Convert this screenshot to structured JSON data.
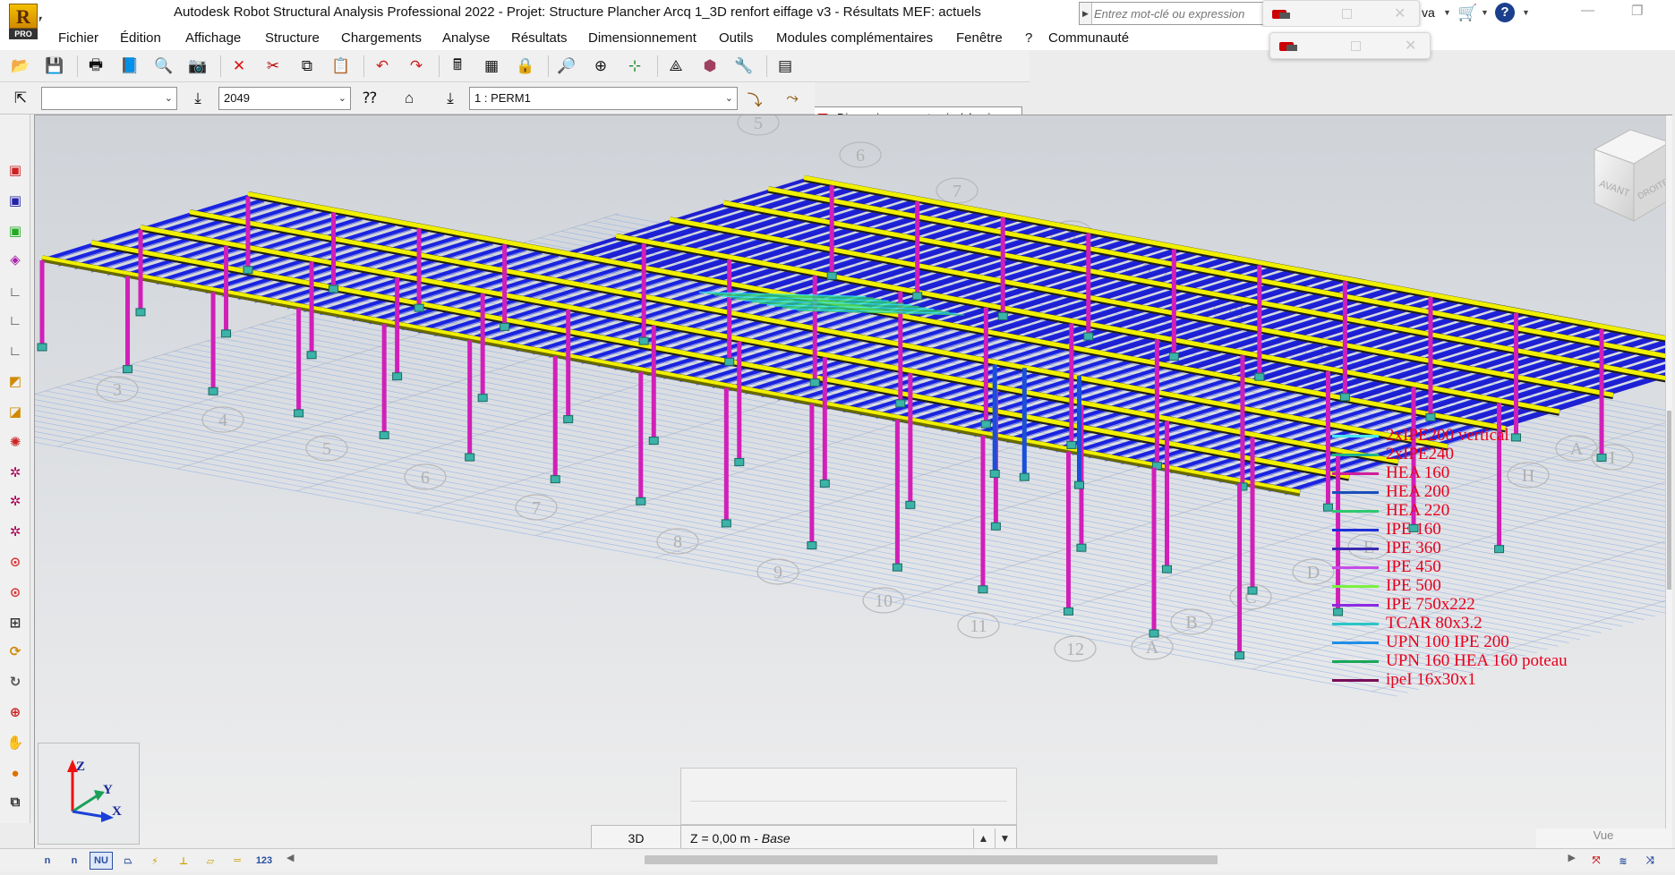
{
  "titlebar": {
    "title": "Autodesk Robot Structural Analysis Professional 2022 - Projet: Structure Plancher Arcq 1_3D renfort eiffage v3 - Résultats MEF: actuels",
    "logo_letter": "R",
    "logo_badge": "PRO",
    "search_placeholder": "Entrez mot-clé ou expression",
    "user_label": "va",
    "help_label": "?"
  },
  "menu": [
    "Fichier",
    "Édition",
    "Affichage",
    "Structure",
    "Chargements",
    "Analyse",
    "Résultats",
    "Dimensionnement",
    "Outils",
    "Modules complémentaires",
    "Fenêtre",
    "?",
    "Communauté"
  ],
  "toolbar": {
    "design_mode": "Dimensionnement acier/alumin",
    "selection_value": "",
    "load_case_number": "2049",
    "load_case": "1 : PERM1"
  },
  "legend": [
    {
      "label": "2xIPE200 vertical",
      "color": "#46e8f2"
    },
    {
      "label": "2xIPE240",
      "color": "#22b38a"
    },
    {
      "label": "HEA 160",
      "color": "#d11f9b"
    },
    {
      "label": "HEA 200",
      "color": "#1a4fb8"
    },
    {
      "label": "HEA 220",
      "color": "#2ec96e"
    },
    {
      "label": "IPE 160",
      "color": "#1d2fd8"
    },
    {
      "label": "IPE 360",
      "color": "#3a2bb0"
    },
    {
      "label": "IPE 450",
      "color": "#c64de8"
    },
    {
      "label": "IPE 500",
      "color": "#7cf040"
    },
    {
      "label": "IPE 750x222",
      "color": "#8c2ae0"
    },
    {
      "label": "TCAR 80x3.2",
      "color": "#2ac6c6"
    },
    {
      "label": "UPN 100 IPE 200",
      "color": "#1f8ee8"
    },
    {
      "label": "UPN 160 HEA 160 poteau",
      "color": "#19a858"
    },
    {
      "label": "ipeI 16x30x1",
      "color": "#7a0e5a"
    }
  ],
  "viewcube": {
    "front": "AVANT",
    "right": "DROITE"
  },
  "grid_labels": {
    "top_numbers": [
      "5",
      "6",
      "7",
      "8",
      "9",
      "10",
      "11",
      "12"
    ],
    "right_letters": [
      "B",
      "A",
      "I",
      "H"
    ],
    "left_numbers": [
      "3",
      "4",
      "5",
      "6",
      "7",
      "8",
      "9",
      "10",
      "11",
      "12"
    ],
    "bottom_letters": [
      "E",
      "D",
      "C",
      "B",
      "A"
    ]
  },
  "axes": {
    "z": "Z",
    "y": "Y",
    "x": "X"
  },
  "statusbar": {
    "view": "3D",
    "z_prefix": "Z = 0,00 m - ",
    "z_plane": "Base",
    "view_panel": "Vue"
  },
  "bottom_tools": [
    "n",
    "n",
    "NU",
    "",
    "",
    "",
    "",
    "",
    "123"
  ],
  "colors": {
    "column": "#d21fb8",
    "joist": "#1a24e0",
    "beam": "#f0f000",
    "support": "#3bb3a8",
    "grid_line": "#7ea6e8"
  }
}
